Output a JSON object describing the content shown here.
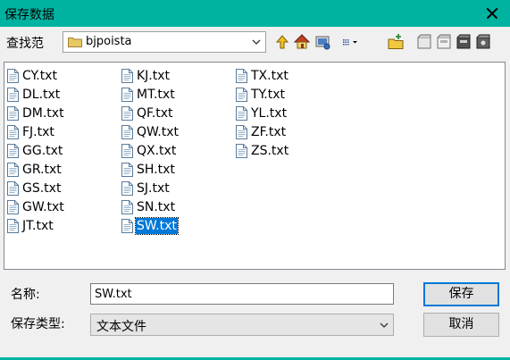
{
  "window": {
    "title": "保存数据"
  },
  "lookin": {
    "label": "查找范",
    "folder": "bjpoista"
  },
  "toolbar": {
    "icons": [
      "up-folder-icon",
      "home-icon",
      "desktop-icon",
      "view-menu-icon",
      "new-folder-icon",
      "drive-1-icon",
      "drive-2-icon",
      "drive-3-icon",
      "drive-4-icon"
    ]
  },
  "files": {
    "columns": [
      [
        "CY.txt",
        "DL.txt",
        "DM.txt",
        "FJ.txt",
        "GG.txt",
        "GR.txt",
        "GS.txt",
        "GW.txt",
        "JT.txt"
      ],
      [
        "KJ.txt",
        "MT.txt",
        "QF.txt",
        "QW.txt",
        "QX.txt",
        "SH.txt",
        "SJ.txt",
        "SN.txt",
        "SW.txt"
      ],
      [
        "TX.txt",
        "TY.txt",
        "YL.txt",
        "ZF.txt",
        "ZS.txt"
      ]
    ],
    "selected": "SW.txt"
  },
  "form": {
    "name_label": "名称:",
    "name_value": "SW.txt",
    "type_label": "保存类型:",
    "type_value": "文本文件"
  },
  "buttons": {
    "save": "保存",
    "cancel": "取消"
  },
  "colors": {
    "titlebar": "#00b3a1",
    "selection": "#0078d7"
  }
}
